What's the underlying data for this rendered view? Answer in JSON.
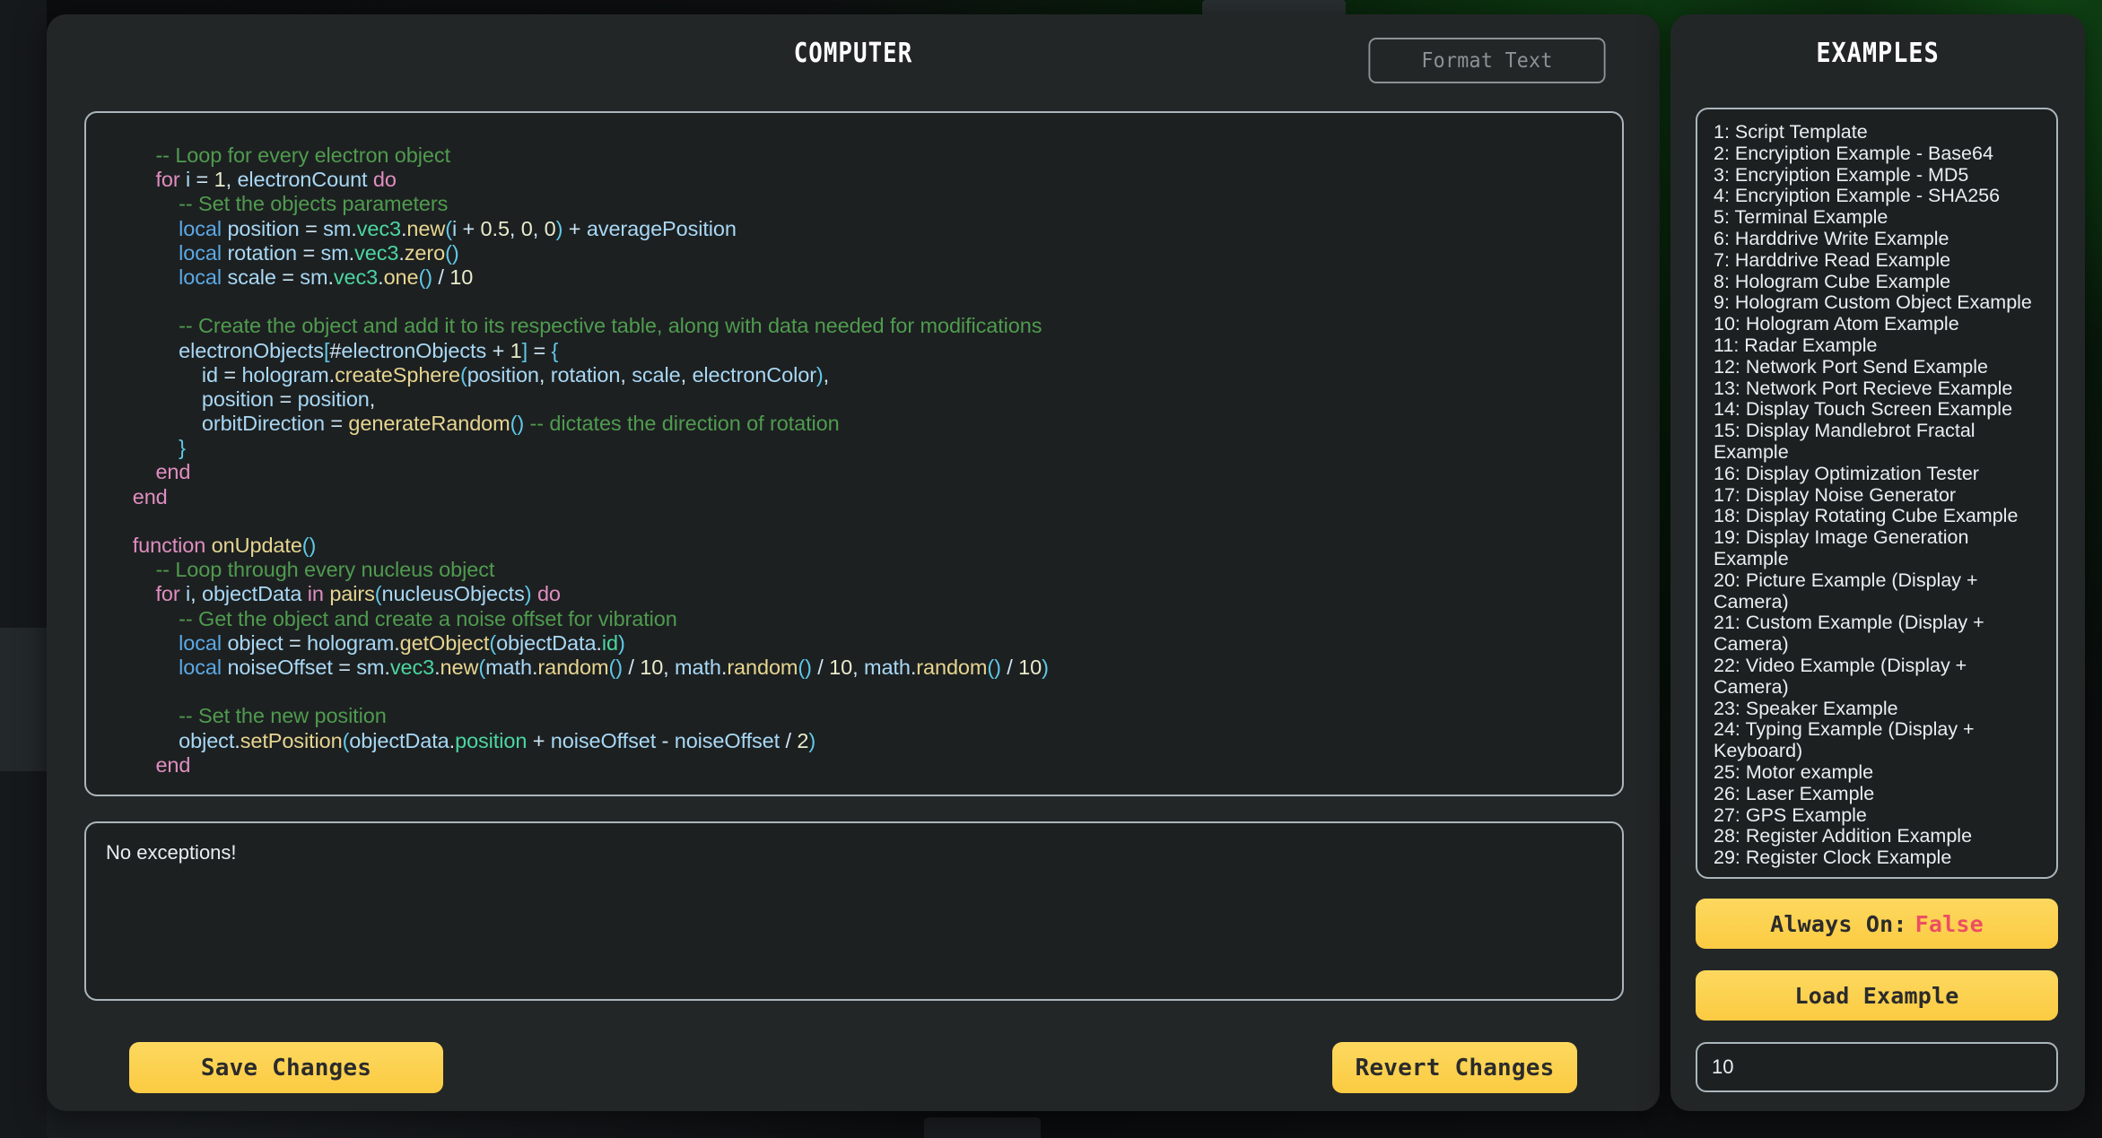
{
  "window": {
    "title": "COMPUTER",
    "format_text_label": "Format Text"
  },
  "code": {
    "lines": [
      [
        {
          "t": "        ",
          "c": "plain"
        },
        {
          "t": "-- Loop for every electron object",
          "c": "com"
        }
      ],
      [
        {
          "t": "        ",
          "c": "plain"
        },
        {
          "t": "for",
          "c": "kw"
        },
        {
          "t": " ",
          "c": "plain"
        },
        {
          "t": "i",
          "c": "var"
        },
        {
          "t": " = ",
          "c": "plain"
        },
        {
          "t": "1",
          "c": "num"
        },
        {
          "t": ", ",
          "c": "plain"
        },
        {
          "t": "electronCount",
          "c": "var"
        },
        {
          "t": " ",
          "c": "plain"
        },
        {
          "t": "do",
          "c": "kw"
        }
      ],
      [
        {
          "t": "            ",
          "c": "plain"
        },
        {
          "t": "-- Set the objects parameters",
          "c": "com"
        }
      ],
      [
        {
          "t": "            ",
          "c": "plain"
        },
        {
          "t": "local",
          "c": "loc"
        },
        {
          "t": " ",
          "c": "plain"
        },
        {
          "t": "position",
          "c": "var"
        },
        {
          "t": " = ",
          "c": "plain"
        },
        {
          "t": "sm",
          "c": "var"
        },
        {
          "t": ".",
          "c": "plain"
        },
        {
          "t": "vec3",
          "c": "lib"
        },
        {
          "t": ".",
          "c": "plain"
        },
        {
          "t": "new",
          "c": "fn"
        },
        {
          "t": "(",
          "c": "pun"
        },
        {
          "t": "i",
          "c": "var"
        },
        {
          "t": " + ",
          "c": "plain"
        },
        {
          "t": "0.5",
          "c": "num"
        },
        {
          "t": ", ",
          "c": "plain"
        },
        {
          "t": "0",
          "c": "num"
        },
        {
          "t": ", ",
          "c": "plain"
        },
        {
          "t": "0",
          "c": "num"
        },
        {
          "t": ")",
          "c": "pun"
        },
        {
          "t": " + ",
          "c": "plain"
        },
        {
          "t": "averagePosition",
          "c": "var"
        }
      ],
      [
        {
          "t": "            ",
          "c": "plain"
        },
        {
          "t": "local",
          "c": "loc"
        },
        {
          "t": " ",
          "c": "plain"
        },
        {
          "t": "rotation",
          "c": "var"
        },
        {
          "t": " = ",
          "c": "plain"
        },
        {
          "t": "sm",
          "c": "var"
        },
        {
          "t": ".",
          "c": "plain"
        },
        {
          "t": "vec3",
          "c": "lib"
        },
        {
          "t": ".",
          "c": "plain"
        },
        {
          "t": "zero",
          "c": "fn"
        },
        {
          "t": "()",
          "c": "pun"
        }
      ],
      [
        {
          "t": "            ",
          "c": "plain"
        },
        {
          "t": "local",
          "c": "loc"
        },
        {
          "t": " ",
          "c": "plain"
        },
        {
          "t": "scale",
          "c": "var"
        },
        {
          "t": " = ",
          "c": "plain"
        },
        {
          "t": "sm",
          "c": "var"
        },
        {
          "t": ".",
          "c": "plain"
        },
        {
          "t": "vec3",
          "c": "lib"
        },
        {
          "t": ".",
          "c": "plain"
        },
        {
          "t": "one",
          "c": "fn"
        },
        {
          "t": "()",
          "c": "pun"
        },
        {
          "t": " / ",
          "c": "plain"
        },
        {
          "t": "10",
          "c": "num"
        }
      ],
      [],
      [
        {
          "t": "            ",
          "c": "plain"
        },
        {
          "t": "-- Create the object and add it to its respective table, along with data needed for modifications",
          "c": "com"
        }
      ],
      [
        {
          "t": "            ",
          "c": "plain"
        },
        {
          "t": "electronObjects",
          "c": "var"
        },
        {
          "t": "[",
          "c": "pun"
        },
        {
          "t": "#",
          "c": "plain"
        },
        {
          "t": "electronObjects",
          "c": "var"
        },
        {
          "t": " + ",
          "c": "plain"
        },
        {
          "t": "1",
          "c": "num"
        },
        {
          "t": "]",
          "c": "pun"
        },
        {
          "t": " = ",
          "c": "plain"
        },
        {
          "t": "{",
          "c": "pun"
        }
      ],
      [
        {
          "t": "                ",
          "c": "plain"
        },
        {
          "t": "id",
          "c": "var"
        },
        {
          "t": " = ",
          "c": "plain"
        },
        {
          "t": "hologram",
          "c": "var"
        },
        {
          "t": ".",
          "c": "plain"
        },
        {
          "t": "createSphere",
          "c": "fn"
        },
        {
          "t": "(",
          "c": "pun"
        },
        {
          "t": "position",
          "c": "var"
        },
        {
          "t": ", ",
          "c": "plain"
        },
        {
          "t": "rotation",
          "c": "var"
        },
        {
          "t": ", ",
          "c": "plain"
        },
        {
          "t": "scale",
          "c": "var"
        },
        {
          "t": ", ",
          "c": "plain"
        },
        {
          "t": "electronColor",
          "c": "var"
        },
        {
          "t": ")",
          "c": "pun"
        },
        {
          "t": ",",
          "c": "plain"
        }
      ],
      [
        {
          "t": "                ",
          "c": "plain"
        },
        {
          "t": "position",
          "c": "var"
        },
        {
          "t": " = ",
          "c": "plain"
        },
        {
          "t": "position",
          "c": "var"
        },
        {
          "t": ",",
          "c": "plain"
        }
      ],
      [
        {
          "t": "                ",
          "c": "plain"
        },
        {
          "t": "orbitDirection",
          "c": "var"
        },
        {
          "t": " = ",
          "c": "plain"
        },
        {
          "t": "generateRandom",
          "c": "fn"
        },
        {
          "t": "()",
          "c": "pun"
        },
        {
          "t": " ",
          "c": "plain"
        },
        {
          "t": "-- dictates the direction of rotation",
          "c": "com"
        }
      ],
      [
        {
          "t": "            ",
          "c": "plain"
        },
        {
          "t": "}",
          "c": "pun"
        }
      ],
      [
        {
          "t": "        ",
          "c": "plain"
        },
        {
          "t": "end",
          "c": "kw"
        }
      ],
      [
        {
          "t": "    ",
          "c": "plain"
        },
        {
          "t": "end",
          "c": "kw"
        }
      ],
      [],
      [
        {
          "t": "    ",
          "c": "plain"
        },
        {
          "t": "function",
          "c": "kw"
        },
        {
          "t": " ",
          "c": "plain"
        },
        {
          "t": "onUpdate",
          "c": "fn"
        },
        {
          "t": "()",
          "c": "pun"
        }
      ],
      [
        {
          "t": "        ",
          "c": "plain"
        },
        {
          "t": "-- Loop through every nucleus object",
          "c": "com"
        }
      ],
      [
        {
          "t": "        ",
          "c": "plain"
        },
        {
          "t": "for",
          "c": "kw"
        },
        {
          "t": " ",
          "c": "plain"
        },
        {
          "t": "i",
          "c": "var"
        },
        {
          "t": ", ",
          "c": "plain"
        },
        {
          "t": "objectData",
          "c": "var"
        },
        {
          "t": " ",
          "c": "plain"
        },
        {
          "t": "in",
          "c": "kw"
        },
        {
          "t": " ",
          "c": "plain"
        },
        {
          "t": "pairs",
          "c": "fn"
        },
        {
          "t": "(",
          "c": "pun"
        },
        {
          "t": "nucleusObjects",
          "c": "var"
        },
        {
          "t": ")",
          "c": "pun"
        },
        {
          "t": " ",
          "c": "plain"
        },
        {
          "t": "do",
          "c": "kw"
        }
      ],
      [
        {
          "t": "            ",
          "c": "plain"
        },
        {
          "t": "-- Get the object and create a noise offset for vibration",
          "c": "com"
        }
      ],
      [
        {
          "t": "            ",
          "c": "plain"
        },
        {
          "t": "local",
          "c": "loc"
        },
        {
          "t": " ",
          "c": "plain"
        },
        {
          "t": "object",
          "c": "var"
        },
        {
          "t": " = ",
          "c": "plain"
        },
        {
          "t": "hologram",
          "c": "var"
        },
        {
          "t": ".",
          "c": "plain"
        },
        {
          "t": "getObject",
          "c": "fn"
        },
        {
          "t": "(",
          "c": "pun"
        },
        {
          "t": "objectData",
          "c": "var"
        },
        {
          "t": ".",
          "c": "plain"
        },
        {
          "t": "id",
          "c": "lib"
        },
        {
          "t": ")",
          "c": "pun"
        }
      ],
      [
        {
          "t": "            ",
          "c": "plain"
        },
        {
          "t": "local",
          "c": "loc"
        },
        {
          "t": " ",
          "c": "plain"
        },
        {
          "t": "noiseOffset",
          "c": "var"
        },
        {
          "t": " = ",
          "c": "plain"
        },
        {
          "t": "sm",
          "c": "var"
        },
        {
          "t": ".",
          "c": "plain"
        },
        {
          "t": "vec3",
          "c": "lib"
        },
        {
          "t": ".",
          "c": "plain"
        },
        {
          "t": "new",
          "c": "fn"
        },
        {
          "t": "(",
          "c": "pun"
        },
        {
          "t": "math",
          "c": "var"
        },
        {
          "t": ".",
          "c": "plain"
        },
        {
          "t": "random",
          "c": "fn"
        },
        {
          "t": "()",
          "c": "pun"
        },
        {
          "t": " / ",
          "c": "plain"
        },
        {
          "t": "10",
          "c": "num"
        },
        {
          "t": ", ",
          "c": "plain"
        },
        {
          "t": "math",
          "c": "var"
        },
        {
          "t": ".",
          "c": "plain"
        },
        {
          "t": "random",
          "c": "fn"
        },
        {
          "t": "()",
          "c": "pun"
        },
        {
          "t": " / ",
          "c": "plain"
        },
        {
          "t": "10",
          "c": "num"
        },
        {
          "t": ", ",
          "c": "plain"
        },
        {
          "t": "math",
          "c": "var"
        },
        {
          "t": ".",
          "c": "plain"
        },
        {
          "t": "random",
          "c": "fn"
        },
        {
          "t": "()",
          "c": "pun"
        },
        {
          "t": " / ",
          "c": "plain"
        },
        {
          "t": "10",
          "c": "num"
        },
        {
          "t": ")",
          "c": "pun"
        }
      ],
      [],
      [
        {
          "t": "            ",
          "c": "plain"
        },
        {
          "t": "-- Set the new position",
          "c": "com"
        }
      ],
      [
        {
          "t": "            ",
          "c": "plain"
        },
        {
          "t": "object",
          "c": "var"
        },
        {
          "t": ".",
          "c": "plain"
        },
        {
          "t": "setPosition",
          "c": "fn"
        },
        {
          "t": "(",
          "c": "pun"
        },
        {
          "t": "objectData",
          "c": "var"
        },
        {
          "t": ".",
          "c": "plain"
        },
        {
          "t": "position",
          "c": "lib"
        },
        {
          "t": " + ",
          "c": "plain"
        },
        {
          "t": "noiseOffset",
          "c": "var"
        },
        {
          "t": " - ",
          "c": "plain"
        },
        {
          "t": "noiseOffset",
          "c": "var"
        },
        {
          "t": " / ",
          "c": "plain"
        },
        {
          "t": "2",
          "c": "num"
        },
        {
          "t": ")",
          "c": "pun"
        }
      ],
      [
        {
          "t": "        ",
          "c": "plain"
        },
        {
          "t": "end",
          "c": "kw"
        }
      ]
    ]
  },
  "exceptions": {
    "text": "No exceptions!"
  },
  "buttons": {
    "save_changes": "Save Changes",
    "revert_changes": "Revert Changes"
  },
  "examples_panel": {
    "title": "EXAMPLES",
    "items": [
      "1: Script Template",
      "2: Encryiption Example - Base64",
      "3: Encryiption Example - MD5",
      "4: Encryiption Example - SHA256",
      "5: Terminal Example",
      "6: Harddrive Write Example",
      "7: Harddrive Read Example",
      "8: Hologram Cube Example",
      "9: Hologram Custom Object Example",
      "10: Hologram Atom Example",
      "11: Radar Example",
      "12: Network Port Send Example",
      "13: Network Port Recieve Example",
      "14: Display Touch Screen Example",
      "15: Display Mandlebrot Fractal Example",
      "16: Display Optimization Tester",
      "17: Display Noise Generator",
      "18: Display Rotating Cube Example",
      "19: Display Image Generation Example",
      "20: Picture Example (Display + Camera)",
      "21: Custom Example (Display + Camera)",
      "22: Video Example (Display + Camera)",
      "23: Speaker Example",
      "24: Typing Example (Display + Keyboard)",
      "25: Motor example",
      "26: Laser Example",
      "27: GPS Example",
      "28: Register Addition Example",
      "29: Register Clock Example"
    ],
    "always_on_label": "Always On:",
    "always_on_value": "False",
    "load_example_label": "Load Example",
    "example_number_value": "10"
  },
  "colors": {
    "accent_yellow": "#fbcb42",
    "panel_bg": "#232627",
    "field_bg": "#1d2021",
    "border": "#aab6bb",
    "false_red": "#eb4f62"
  }
}
